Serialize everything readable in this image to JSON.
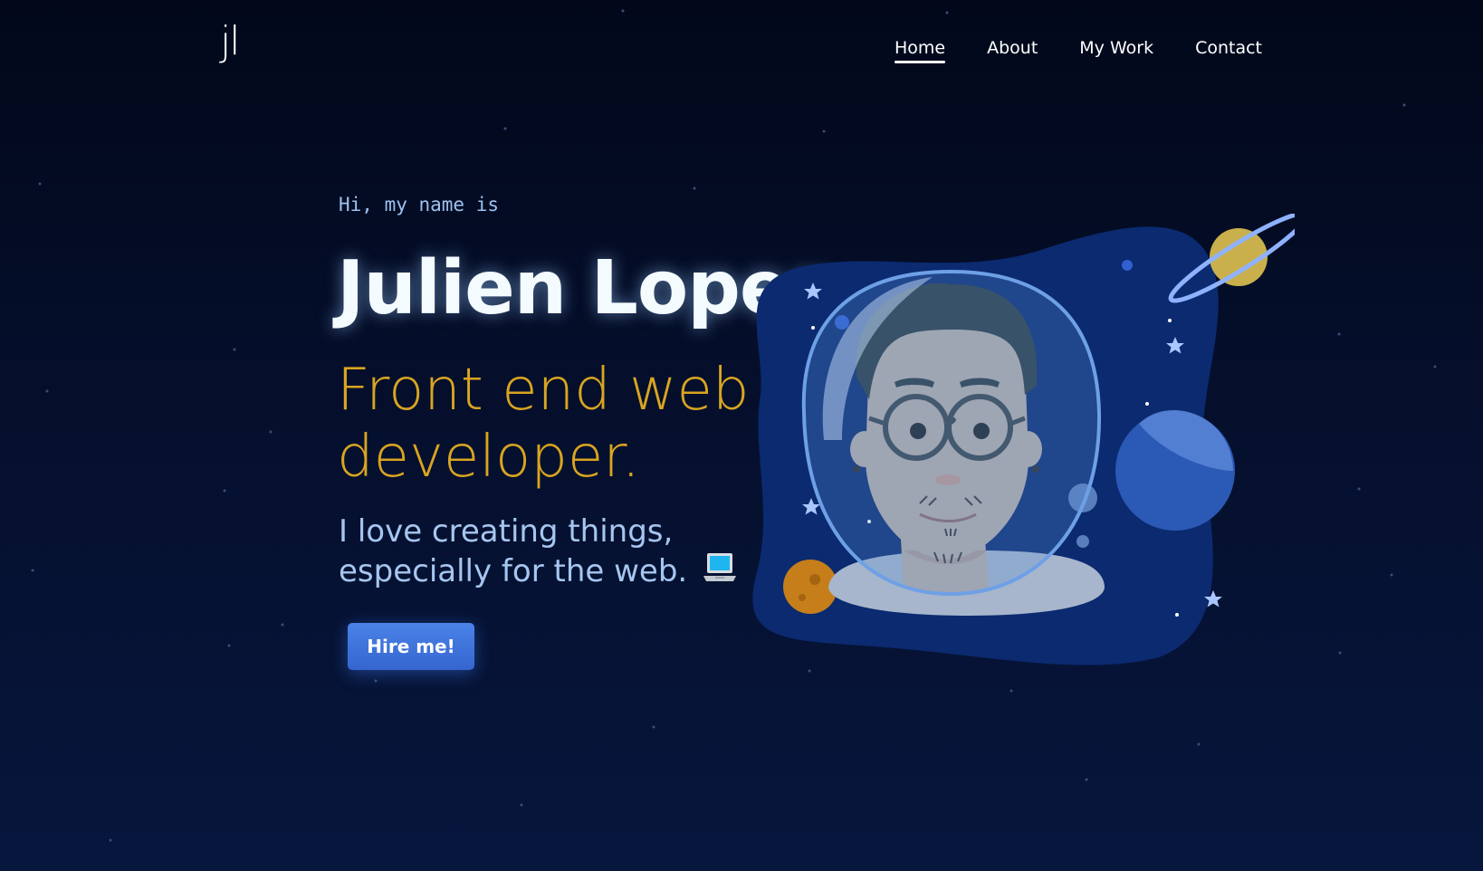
{
  "brand": {
    "logo_text": "jl"
  },
  "nav": {
    "items": [
      {
        "label": "Home",
        "active": true
      },
      {
        "label": "About",
        "active": false
      },
      {
        "label": "My Work",
        "active": false
      },
      {
        "label": "Contact",
        "active": false
      }
    ]
  },
  "hero": {
    "intro": "Hi, my name is",
    "name": "Julien Lopez,",
    "role": "Front end web developer.",
    "bio": "I love creating things, especially for the web.",
    "cta_label": "Hire me!"
  },
  "colors": {
    "background": "#050f2c",
    "accent_gold": "#d9a521",
    "text_blue": "#a6c6ef",
    "button_blue": "#3f74dc"
  },
  "icons": {
    "bio_emoji": "laptop-icon",
    "illustration": "astronaut-avatar-illustration"
  }
}
